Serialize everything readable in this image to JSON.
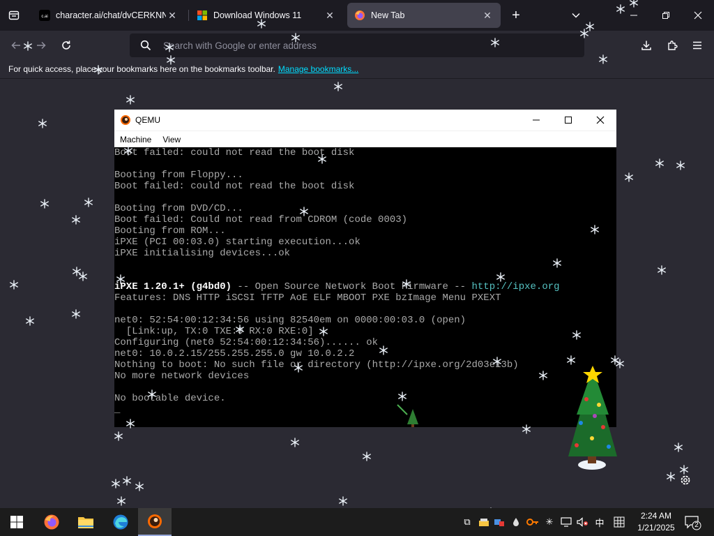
{
  "browser": {
    "tabs": [
      {
        "favicon": "character-ai-icon",
        "title": "character.ai/chat/dvCERKNNTa",
        "active": false
      },
      {
        "favicon": "windows-icon",
        "title": "Download Windows 11",
        "active": false
      },
      {
        "favicon": "firefox-icon",
        "title": "New Tab",
        "active": true
      }
    ],
    "urlbar_placeholder": "Search with Google or enter address",
    "bookmarks_text": "For quick access, place your bookmarks here on the bookmarks toolbar.",
    "bookmarks_link": "Manage bookmarks..."
  },
  "qemu": {
    "title": "QEMU",
    "menu": [
      "Machine",
      "View"
    ],
    "console_lines": [
      {
        "text": "Boot failed: could not read the boot disk",
        "style": "normal"
      },
      {
        "text": "",
        "style": "normal"
      },
      {
        "text": "Booting from Floppy...",
        "style": "normal"
      },
      {
        "text": "Boot failed: could not read the boot disk",
        "style": "normal"
      },
      {
        "text": "",
        "style": "normal"
      },
      {
        "text": "Booting from DVD/CD...",
        "style": "normal"
      },
      {
        "text": "Boot failed: Could not read from CDROM (code 0003)",
        "style": "normal"
      },
      {
        "text": "Booting from ROM...",
        "style": "normal"
      },
      {
        "text": "iPXE (PCI 00:03.0) starting execution...ok",
        "style": "normal"
      },
      {
        "text": "iPXE initialising devices...ok",
        "style": "normal"
      },
      {
        "text": "",
        "style": "normal"
      },
      {
        "text": "",
        "style": "normal"
      },
      {
        "text": "",
        "style": "ipxe"
      },
      {
        "text": "Features: DNS HTTP iSCSI TFTP AoE ELF MBOOT PXE bzImage Menu PXEXT",
        "style": "normal"
      },
      {
        "text": "",
        "style": "normal"
      },
      {
        "text": "net0: 52:54:00:12:34:56 using 82540em on 0000:00:03.0 (open)",
        "style": "normal"
      },
      {
        "text": "  [Link:up, TX:0 TXE:0 RX:0 RXE:0]",
        "style": "normal"
      },
      {
        "text": "Configuring (net0 52:54:00:12:34:56)...... ok",
        "style": "normal"
      },
      {
        "text": "net0: 10.0.2.15/255.255.255.0 gw 10.0.2.2",
        "style": "normal"
      },
      {
        "text": "Nothing to boot: No such file or directory (http://ipxe.org/2d03e13b)",
        "style": "normal"
      },
      {
        "text": "No more network devices",
        "style": "normal"
      },
      {
        "text": "",
        "style": "normal"
      },
      {
        "text": "No bootable device.",
        "style": "normal"
      },
      {
        "text": "_",
        "style": "normal"
      }
    ],
    "ipxe_banner": {
      "version": "iPXE 1.20.1+ (g4bd0)",
      "middle": " -- Open Source Network Boot Firmware -- ",
      "url": "http://ipxe.org"
    }
  },
  "taskbar": {
    "apps": [
      "start-icon",
      "firefox-icon",
      "file-explorer-icon",
      "edge-icon",
      "qemu-icon"
    ],
    "ime": "中",
    "time": "2:24 AM",
    "date": "1/21/2025",
    "notification_count": "2"
  },
  "colors": {
    "browser_bg": "#2b2a33",
    "tabstrip_bg": "#1c1b22",
    "link": "#00ddff",
    "console_text": "#aaaaaa",
    "console_link": "#55c1c1",
    "taskbar_bg": "#1c1c1c"
  }
}
